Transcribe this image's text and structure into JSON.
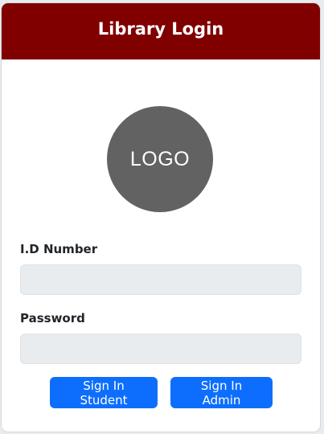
{
  "header": {
    "title": "Library Login",
    "background_color": "#800000"
  },
  "logo": {
    "text": "LOGO",
    "color": "#626262"
  },
  "form": {
    "id_label": "I.D Number",
    "id_value": "",
    "id_placeholder": "",
    "password_label": "Password",
    "password_value": "",
    "password_placeholder": ""
  },
  "buttons": {
    "student_label": "Sign In Student",
    "admin_label": "Sign In Admin",
    "color": "#0d6efd"
  }
}
